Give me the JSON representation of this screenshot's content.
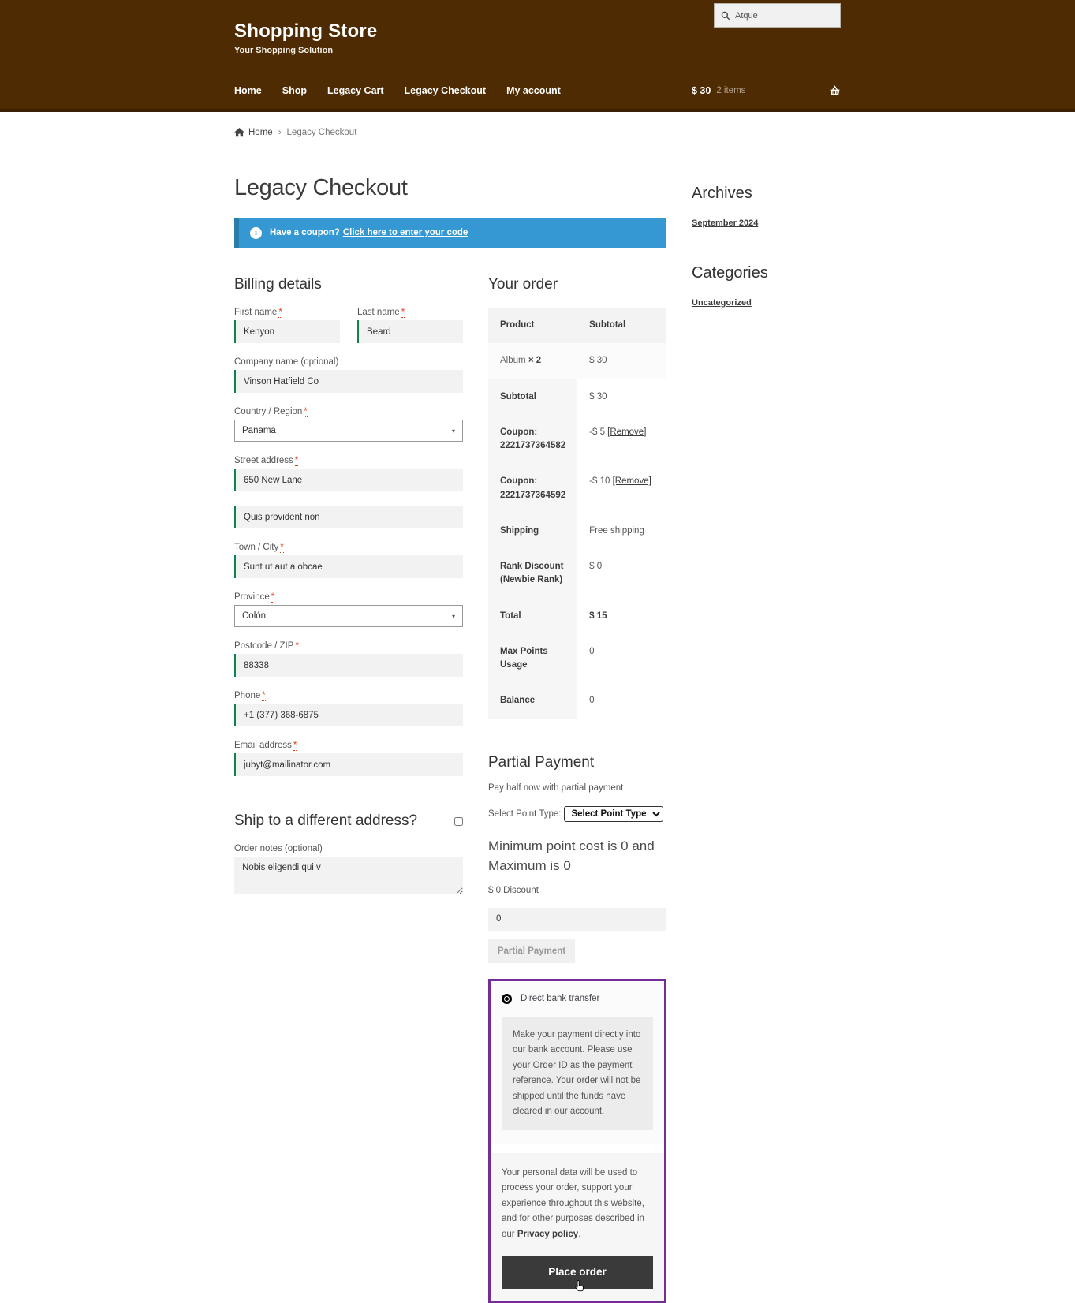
{
  "colors": {
    "header_bg": "#4e2b03",
    "banner_blue": "#3598d3",
    "input_valid_green": "#0f834d",
    "payment_border_purple": "#732d96",
    "place_order_bg": "#3a3a3a",
    "required_red": "#e2401c"
  },
  "icons": {
    "info_glyph": "i",
    "select_caret": "▾"
  },
  "header": {
    "site_title": "Shopping Store",
    "tagline": "Your Shopping Solution",
    "search_placeholder": "Atque",
    "nav_items": [
      "Home",
      "Shop",
      "Legacy Cart",
      "Legacy Checkout",
      "My account"
    ],
    "cart_total": "$ 30",
    "cart_count": "2 items"
  },
  "breadcrumb": {
    "home_label": "Home",
    "separator": "›",
    "current": "Legacy Checkout"
  },
  "page": {
    "title": "Legacy Checkout"
  },
  "coupon_banner": {
    "prefix": "Have a coupon?",
    "link_label": "Click here to enter your code"
  },
  "billing": {
    "heading": "Billing details",
    "required_marker": "*",
    "first_name": {
      "label": "First name",
      "value": "Kenyon"
    },
    "last_name": {
      "label": "Last name",
      "value": "Beard"
    },
    "company": {
      "label": "Company name (optional)",
      "value": "Vinson Hatfield Co"
    },
    "country": {
      "label": "Country / Region",
      "value": "Panama"
    },
    "address_1": {
      "label": "Street address",
      "value": "650 New Lane"
    },
    "address_2": {
      "value": "Quis provident non"
    },
    "city": {
      "label": "Town / City",
      "value": "Sunt ut aut a obcae"
    },
    "province": {
      "label": "Province",
      "value": "Colón"
    },
    "postcode": {
      "label": "Postcode / ZIP",
      "value": "88338"
    },
    "phone": {
      "label": "Phone",
      "value": "+1 (377) 368-6875"
    },
    "email": {
      "label": "Email address",
      "value": "jubyt@mailinator.com"
    },
    "ship_different_heading": "Ship to a different address?",
    "order_notes": {
      "label": "Order notes (optional)",
      "value": "Nobis eligendi qui v"
    }
  },
  "order": {
    "heading": "Your order",
    "columns": {
      "product": "Product",
      "subtotal": "Subtotal"
    },
    "line_item": {
      "name": "Album",
      "qty": "× 2",
      "subtotal": "$ 30"
    },
    "rows": [
      {
        "label": "Subtotal",
        "value": "$ 30"
      },
      {
        "label": "Coupon: 2221737364582",
        "value": "-$ 5 ",
        "link": "[Remove]"
      },
      {
        "label": "Coupon: 2221737364592",
        "value": "-$ 10 ",
        "link": "[Remove]"
      },
      {
        "label": "Shipping",
        "value": "Free shipping"
      },
      {
        "label": "Rank Discount (Newbie Rank)",
        "value": "$ 0"
      },
      {
        "label": "Total",
        "value": "$ 15"
      },
      {
        "label": "Max Points Usage",
        "value": "0"
      },
      {
        "label": "Balance",
        "value": "0"
      }
    ]
  },
  "partial_payment": {
    "heading": "Partial Payment",
    "subtext": "Pay half now with partial payment",
    "select_label": "Select Point Type:",
    "select_value": "Select Point Type",
    "minmax_text": "Minimum point cost is 0 and Maximum is 0",
    "discount_text": "$ 0 Discount",
    "input_value": "0",
    "button_label": "Partial Payment"
  },
  "payment": {
    "method_label": "Direct bank transfer",
    "method_description": "Make your payment directly into our bank account. Please use your Order ID as the payment reference. Your order will not be shipped until the funds have cleared in our account.",
    "privacy_before": "Your personal data will be used to process your order, support your experience throughout this website, and for other purposes described in our ",
    "privacy_link": "Privacy policy",
    "privacy_after": ".",
    "place_order_label": "Place order"
  },
  "sidebar": {
    "archives_heading": "Archives",
    "archives_link": "September 2024",
    "categories_heading": "Categories",
    "categories_link": "Uncategorized"
  }
}
